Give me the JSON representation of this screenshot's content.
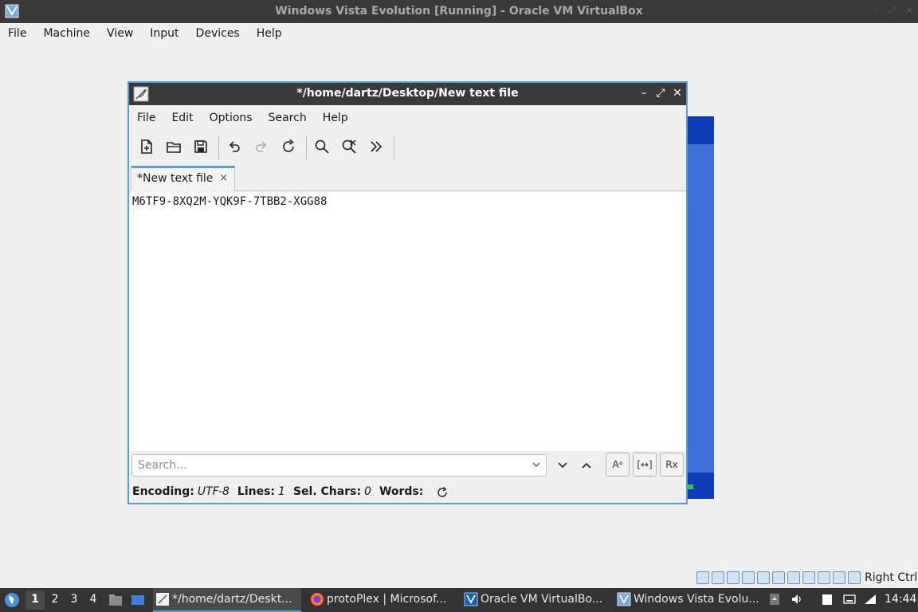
{
  "vbox": {
    "title": "Windows Vista Evolution [Running] - Oracle VM VirtualBox",
    "menu": [
      "File",
      "Machine",
      "View",
      "Input",
      "Devices",
      "Help"
    ],
    "host_key": "Right Ctrl"
  },
  "featherpad": {
    "title": "*/home/dartz/Desktop/New text file",
    "menu": [
      "File",
      "Edit",
      "Options",
      "Search",
      "Help"
    ],
    "tab_label": "*New text file",
    "tab_close": "×",
    "content": "M6TF9-8XQ2M-YQK9F-7TBB2-XGG88",
    "search_placeholder": "Search...",
    "match_case_label": "Aᵃ",
    "whole_word_label": "[↔]",
    "regex_label": "Rx",
    "status": {
      "encoding_label": "Encoding:",
      "encoding_value": "UTF-8",
      "lines_label": "Lines:",
      "lines_value": "1",
      "sel_label": "Sel. Chars:",
      "sel_value": "0",
      "words_label": "Words:"
    }
  },
  "taskbar": {
    "workspaces": [
      "1",
      "2",
      "3",
      "4"
    ],
    "tasks": [
      "*/home/dartz/Deskt...",
      "protoPlex | Microsof...",
      "Oracle VM VirtualBo...",
      "Windows Vista Evolu..."
    ],
    "clock": "14:44"
  },
  "colors": {
    "accent": "#5b9bd5",
    "titlebar": "#3a3a3a",
    "guest_blue": "#3f6fd9"
  }
}
